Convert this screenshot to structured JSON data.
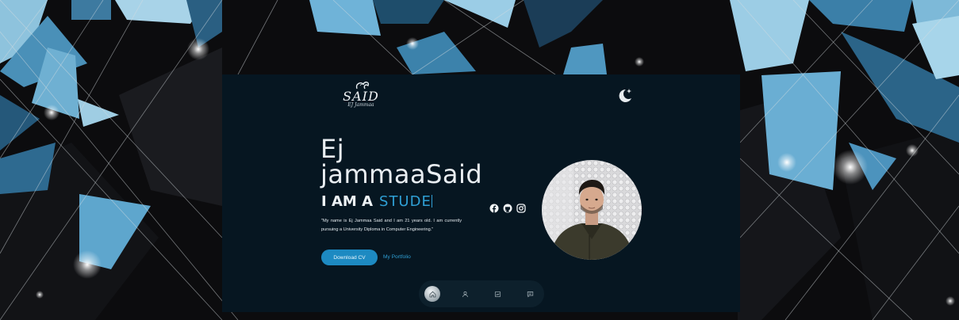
{
  "header": {
    "logo": {
      "text": "SAID",
      "subtext": "EJ Jammaa"
    },
    "theme_toggle_icon": "moon-star-icon"
  },
  "hero": {
    "name_line1": "Ej",
    "name_line2": "jammaaSaid",
    "iam_prefix": "I AM A",
    "iam_role": "STUDE",
    "bio": "\"My name is Ej Jammaa Said and I am 21 years old. I am currently pursuing a University Diploma in Computer Engineering.\"",
    "download_label": "Download CV",
    "portfolio_label": "My Portfolio"
  },
  "socials": [
    "facebook-icon",
    "github-icon",
    "instagram-icon"
  ],
  "nav": {
    "items": [
      "home-icon",
      "user-icon",
      "portfolio-icon",
      "message-icon"
    ],
    "active": "home-icon"
  },
  "colors": {
    "page_bg": "#061621",
    "accent": "#2f9fd4",
    "button": "#1d8ac2",
    "text": "#e9eef2"
  }
}
